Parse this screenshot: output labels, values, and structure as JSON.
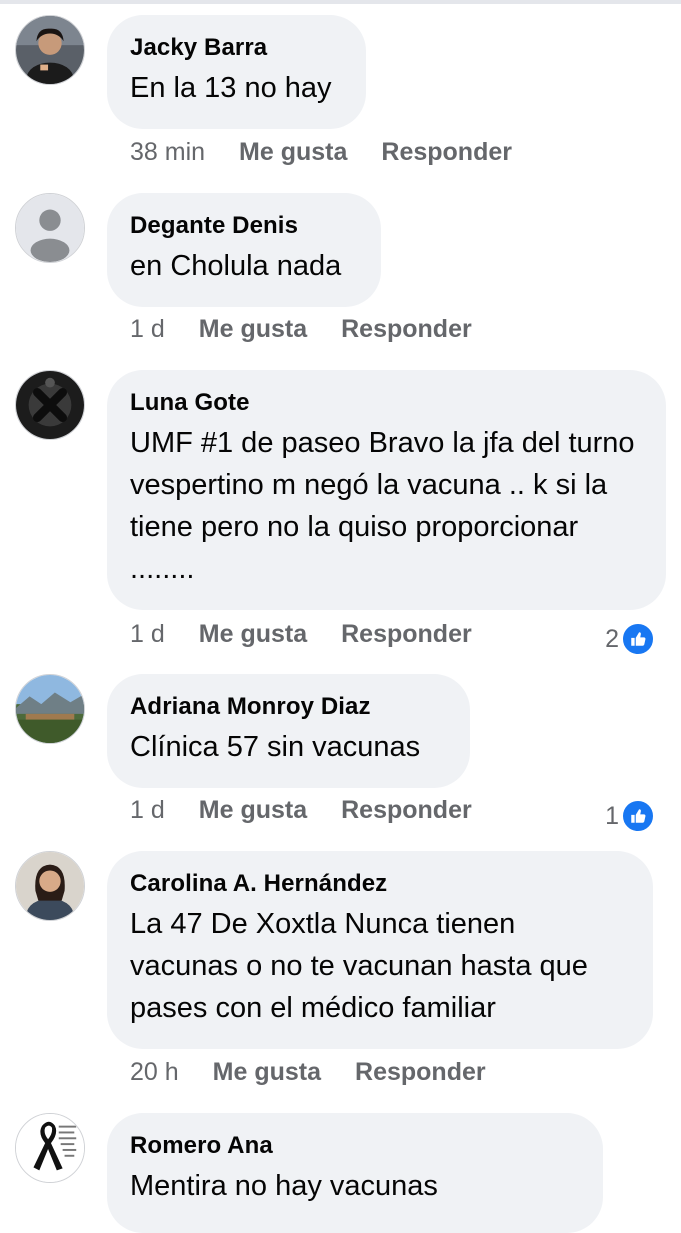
{
  "actions": {
    "like_label": "Me gusta",
    "reply_label": "Responder"
  },
  "colors": {
    "bubble": "#f0f2f5",
    "meta_text": "#65676b",
    "like_blue": "#1877f2"
  },
  "comments": [
    {
      "author": "Jacky Barra",
      "text": "En la 13 no hay",
      "time": "38 min",
      "avatar_icon": "profile-photo-icon"
    },
    {
      "author": "Degante Denis",
      "text": "en Cholula nada",
      "time": "1 d",
      "avatar_icon": "default-profile-icon"
    },
    {
      "author": "Luna Gote",
      "text": "UMF #1 de paseo Bravo la jfa del turno vespertino m negó la vacuna .. k si la tiene pero no la quiso proporcionar ........",
      "time": "1 d",
      "reactions": "2",
      "avatar_icon": "profile-photo-icon"
    },
    {
      "author": "Adriana Monroy Diaz",
      "text": "Clínica 57 sin vacunas",
      "time": "1 d",
      "reactions": "1",
      "avatar_icon": "profile-photo-icon"
    },
    {
      "author": "Carolina A. Hernández",
      "text": "La 47 De Xoxtla Nunca tienen vacunas o no te vacunan hasta que pases con el médico familiar",
      "time": "20 h",
      "avatar_icon": "profile-photo-icon"
    },
    {
      "author": "Romero Ana",
      "text": "Mentira no hay vacunas",
      "avatar_icon": "mourning-ribbon-icon"
    }
  ]
}
